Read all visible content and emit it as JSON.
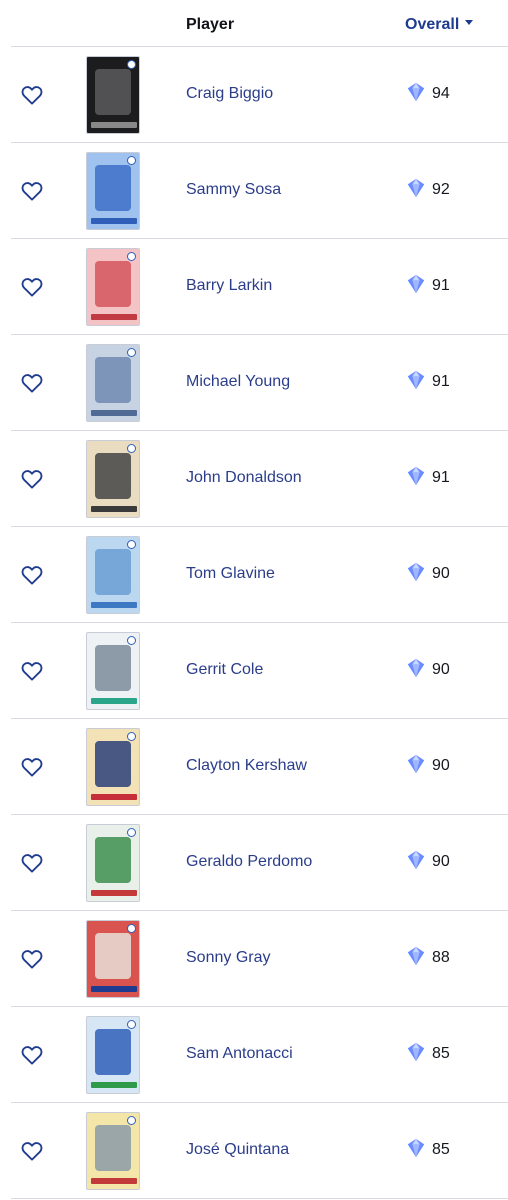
{
  "header": {
    "player_label": "Player",
    "overall_label": "Overall"
  },
  "colors": {
    "accent": "#1f3b8f",
    "link": "#2b3d8a",
    "divider": "#d9dbe1",
    "diamond": "#5a7df5"
  },
  "players": [
    {
      "name": "Craig Biggio",
      "overall": "94",
      "card_theme": "dark"
    },
    {
      "name": "Sammy Sosa",
      "overall": "92",
      "card_theme": "blue"
    },
    {
      "name": "Barry Larkin",
      "overall": "91",
      "card_theme": "red"
    },
    {
      "name": "Michael Young",
      "overall": "91",
      "card_theme": "slate"
    },
    {
      "name": "John Donaldson",
      "overall": "91",
      "card_theme": "tan"
    },
    {
      "name": "Tom Glavine",
      "overall": "90",
      "card_theme": "lightblue"
    },
    {
      "name": "Gerrit Cole",
      "overall": "90",
      "card_theme": "white"
    },
    {
      "name": "Clayton Kershaw",
      "overall": "90",
      "card_theme": "usa"
    },
    {
      "name": "Geraldo Perdomo",
      "overall": "90",
      "card_theme": "green"
    },
    {
      "name": "Sonny Gray",
      "overall": "88",
      "card_theme": "redsox"
    },
    {
      "name": "Sam Antonacci",
      "overall": "85",
      "card_theme": "italy"
    },
    {
      "name": "José Quintana",
      "overall": "85",
      "card_theme": "colombia"
    }
  ]
}
